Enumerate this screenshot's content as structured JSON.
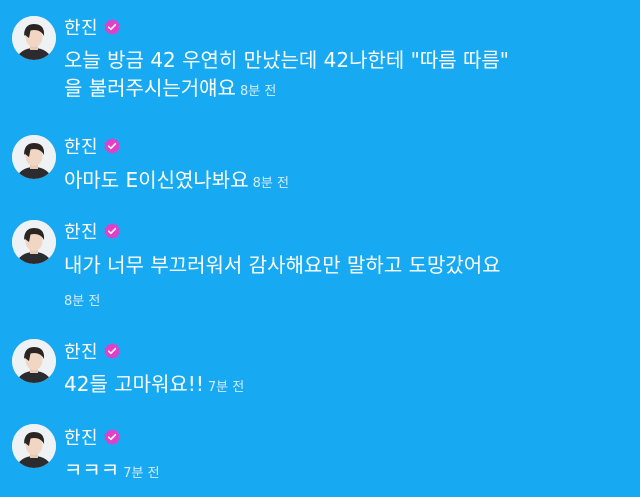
{
  "messages": [
    {
      "author": "한진",
      "lines": [
        "오늘 방금 42 우연히 만났는데 42나한테 \"따름 따름\"",
        "을 불러주시는거얘요"
      ],
      "time": "8분 전"
    },
    {
      "author": "한진",
      "lines": [
        "아마도 E이신였나봐요"
      ],
      "time": "8분 전"
    },
    {
      "author": "한진",
      "lines": [
        "내가 너무 부끄러워서 감사해요만 말하고 도망갔어요"
      ],
      "time": "8분 전"
    },
    {
      "author": "한진",
      "lines": [
        "42들 고마워요!!"
      ],
      "time": "7분 전"
    },
    {
      "author": "한진",
      "lines": [
        "ㅋㅋㅋ"
      ],
      "time": "7분 전"
    }
  ],
  "icons": {
    "avatar": "avatar-icon",
    "verified": "verified-badge-icon"
  },
  "colors": {
    "background": "#17aaf2",
    "text": "#ffffff",
    "time": "#d3ebfb",
    "badge": "#e23ec8"
  }
}
